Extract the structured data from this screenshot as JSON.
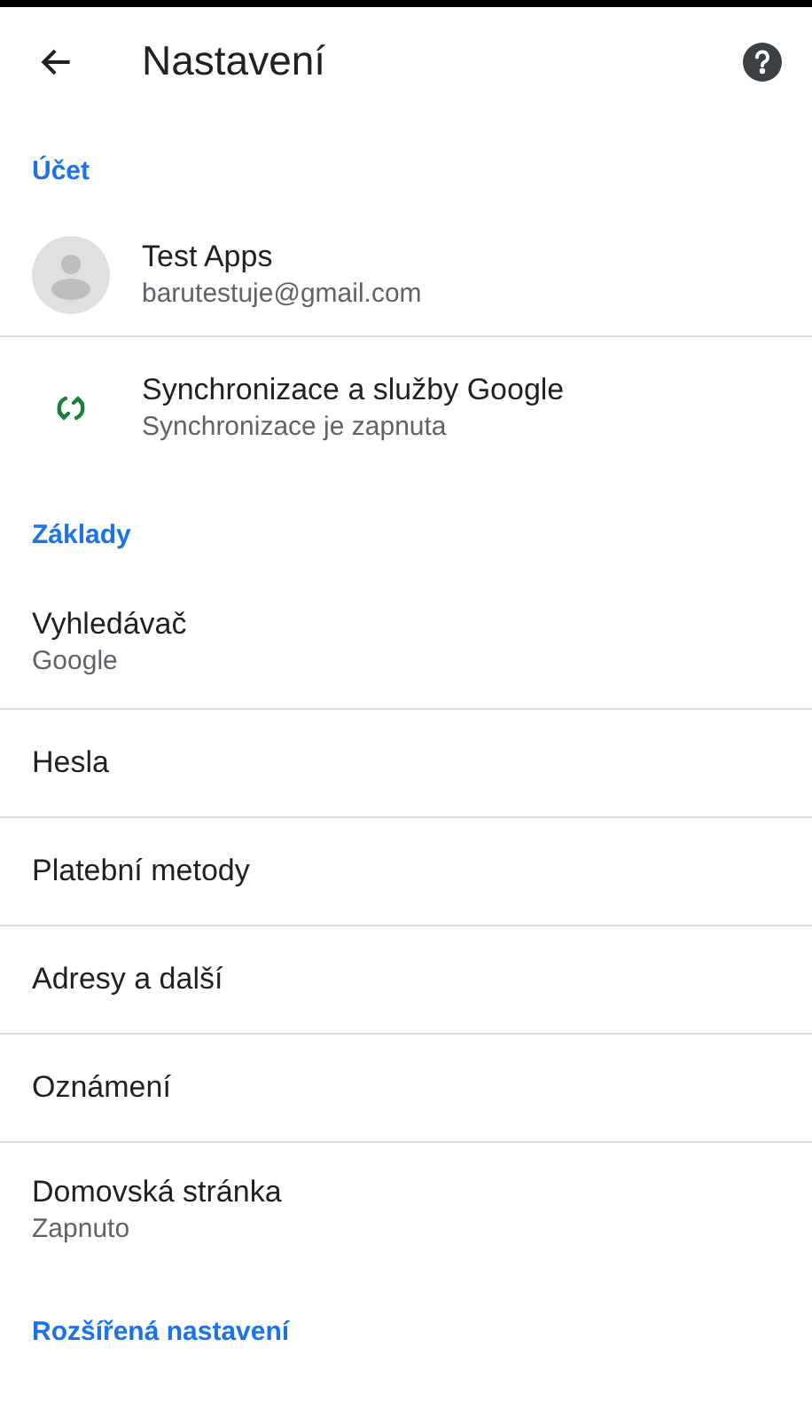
{
  "header": {
    "title": "Nastavení"
  },
  "sections": [
    {
      "heading": "Účet",
      "items": [
        {
          "kind": "avatar",
          "title": "Test Apps",
          "subtitle": "barutestuje@gmail.com"
        },
        {
          "kind": "sync",
          "title": "Synchronizace a služby Google",
          "subtitle": "Synchronizace je zapnuta"
        }
      ]
    },
    {
      "heading": "Základy",
      "items": [
        {
          "kind": "plain",
          "title": "Vyhledávač",
          "subtitle": "Google"
        },
        {
          "kind": "plain",
          "title": "Hesla"
        },
        {
          "kind": "plain",
          "title": "Platební metody"
        },
        {
          "kind": "plain",
          "title": "Adresy a další"
        },
        {
          "kind": "plain",
          "title": "Oznámení"
        },
        {
          "kind": "plain",
          "title": "Domovská stránka",
          "subtitle": "Zapnuto"
        }
      ]
    },
    {
      "heading": "Rozšířená nastavení"
    }
  ]
}
